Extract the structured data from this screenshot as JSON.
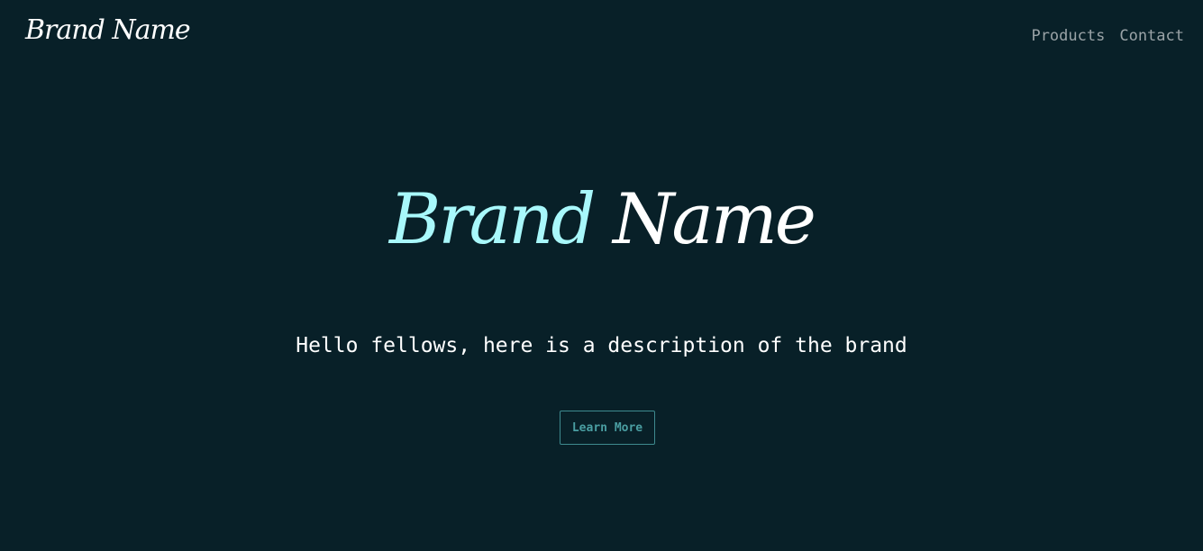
{
  "header": {
    "logo_text": "Brand Name",
    "nav_items": [
      {
        "label": "Products"
      },
      {
        "label": "Contact"
      }
    ]
  },
  "hero": {
    "title_part1": "Brand",
    "title_part2": "Name",
    "description": "Hello fellows, here is a description of the brand",
    "cta_label": "Learn More"
  },
  "colors": {
    "background": "#082028",
    "title_accent": "#a8f8fb",
    "button_accent": "#4a9ea2",
    "nav_text": "#9aa3a7"
  }
}
